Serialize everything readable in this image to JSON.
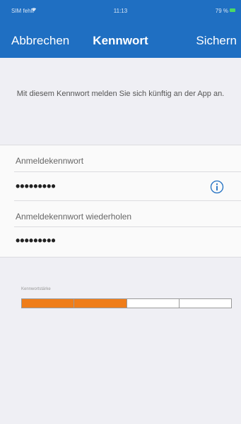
{
  "status_bar": {
    "carrier": "SIM fehlt",
    "time": "11:13",
    "battery": "79 %"
  },
  "nav": {
    "cancel_label": "Abbrechen",
    "title": "Kennwort",
    "save_label": "Sichern"
  },
  "hint_text": "Mit diesem Kennwort melden Sie sich künftig an der App an.",
  "password_field": {
    "label": "Anmeldekennwort",
    "value": "•••••••••"
  },
  "repeat_field": {
    "label": "Anmeldekennwort wiederholen",
    "value": "•••••••••"
  },
  "strength": {
    "label": "Kennwortstärke",
    "filled_segments": 2,
    "total_segments": 4
  },
  "colors": {
    "header": "#1f6fc2",
    "strength_fill": "#ef7d1a",
    "info_icon": "#1f6fc2"
  }
}
